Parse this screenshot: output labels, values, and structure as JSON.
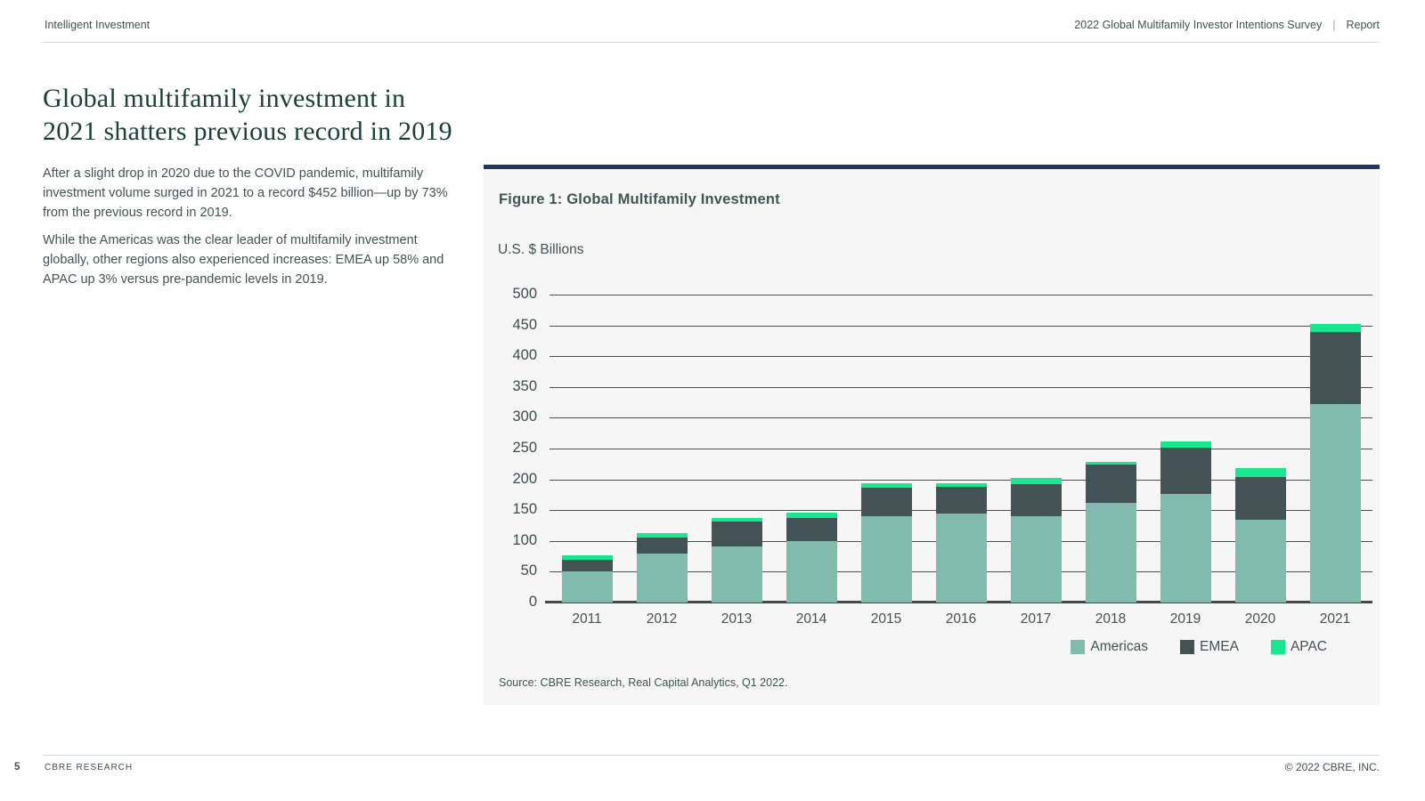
{
  "header": {
    "left": "Intelligent Investment",
    "right_primary": "2022 Global Multifamily Investor Intentions Survey",
    "separator": "|",
    "right_secondary": "Report"
  },
  "article": {
    "title": "Global multifamily investment in 2021 shatters previous record in 2019",
    "paragraphs": [
      "After a slight drop in 2020 due to the COVID pandemic, multifamily investment volume surged in 2021 to a record $452 billion—up by 73% from the previous record in 2019.",
      "While the Americas was the clear leader of multifamily investment globally, other regions also experienced increases: EMEA up 58% and APAC up 3% versus pre-pandemic levels in 2019."
    ]
  },
  "figure": {
    "title": "Figure 1:  Global Multifamily Investment",
    "source": "Source: CBRE Research, Real Capital Analytics, Q1 2022."
  },
  "chart_data": {
    "type": "bar",
    "stacked": true,
    "title": "Figure 1: Global Multifamily Investment",
    "ylabel": "U.S. $ Billions",
    "categories": [
      "2011",
      "2012",
      "2013",
      "2014",
      "2015",
      "2016",
      "2017",
      "2018",
      "2019",
      "2020",
      "2021"
    ],
    "series": [
      {
        "name": "Americas",
        "color": "#80BBAD",
        "values": [
          51,
          79,
          91,
          100,
          140,
          145,
          140,
          162,
          177,
          135,
          323
        ]
      },
      {
        "name": "EMEA",
        "color": "#435254",
        "values": [
          19,
          27,
          40,
          37,
          47,
          43,
          52,
          62,
          74,
          69,
          116
        ]
      },
      {
        "name": "APAC",
        "color": "#17E88F",
        "values": [
          7,
          6,
          6,
          9,
          6,
          5,
          10,
          5,
          10,
          14,
          13
        ]
      }
    ],
    "totals": [
      77,
      112,
      137,
      146,
      193,
      193,
      202,
      229,
      261,
      218,
      452
    ],
    "ylim": [
      0,
      500
    ],
    "ytick_step": 50,
    "grid": true,
    "legend_position": "bottom-right"
  },
  "footer": {
    "page_number": "5",
    "left": "CBRE RESEARCH",
    "right": "© 2022 CBRE, INC."
  },
  "colors": {
    "accent_navy": "#1F3765",
    "panel_bg": "#F5F6F5",
    "americas": "#80BBAD",
    "emea": "#435254",
    "apac": "#17E88F",
    "title_green": "#1A4037",
    "body_text": "#435254",
    "gridline": "#4a5253"
  }
}
